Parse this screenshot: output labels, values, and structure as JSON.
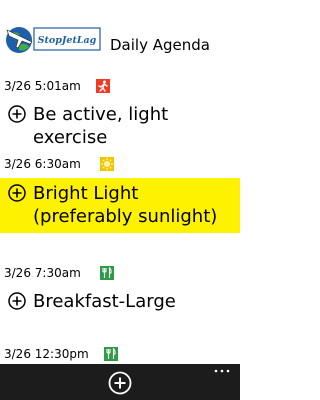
{
  "app": {
    "logo_text": "StopJetLag",
    "title": "Daily Agenda"
  },
  "agenda": [
    {
      "time": "3/26  5:01am",
      "icon": "running-icon",
      "icon_color": "#ef3b24",
      "text": "Be active, light exercise",
      "highlighted": false
    },
    {
      "time": "3/26  6:30am",
      "icon": "sun-icon",
      "icon_color": "#f5c400",
      "text": "Bright Light (preferably sunlight)",
      "highlighted": true
    },
    {
      "time": "3/26  7:30am",
      "icon": "fork-knife-icon",
      "icon_color": "#2e9b47",
      "text": "Breakfast-Large",
      "highlighted": false
    },
    {
      "time": "3/26 12:30pm",
      "icon": "fork-knife-icon",
      "icon_color": "#2e9b47",
      "text": "",
      "highlighted": false
    }
  ],
  "colors": {
    "highlight": "#fff200",
    "app_bar": "#1c1c1c"
  },
  "app_bar": {
    "add_icon": "plus-circle-icon",
    "more_icon": "ellipsis-icon"
  }
}
